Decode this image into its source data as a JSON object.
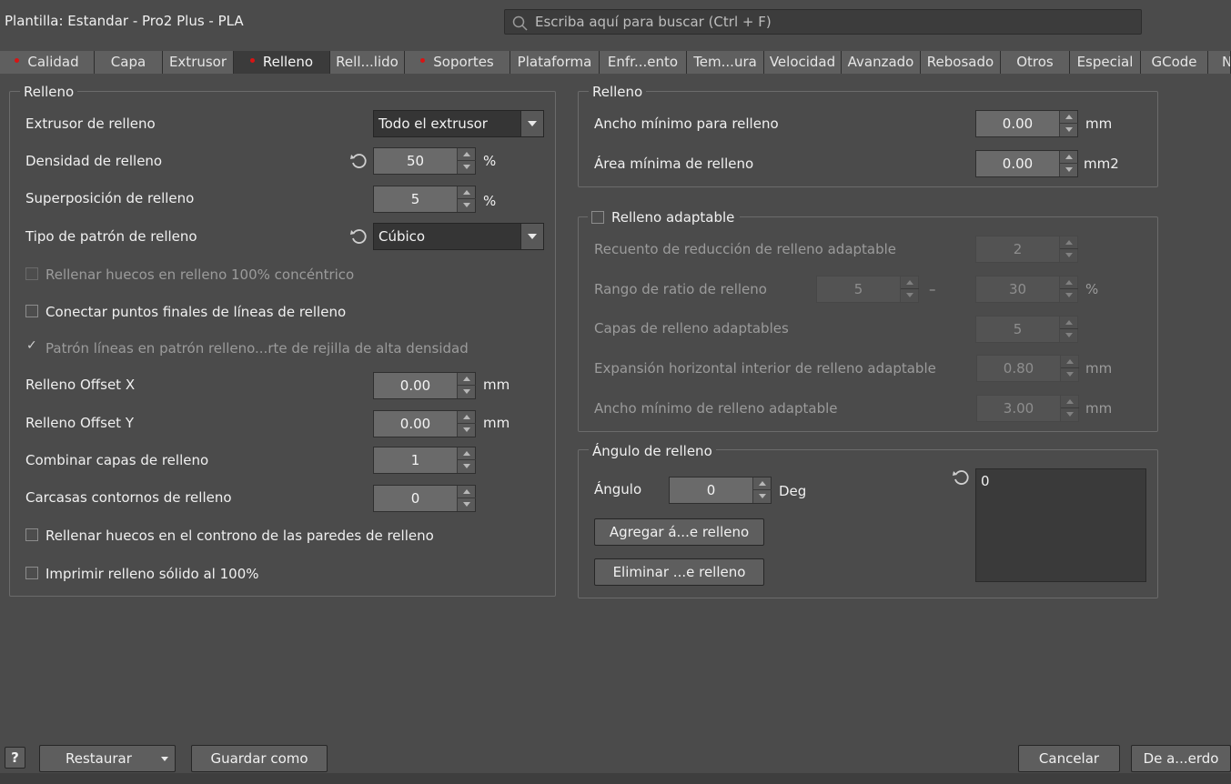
{
  "header": {
    "title": "Plantilla: Estandar - Pro2 Plus - PLA",
    "search_placeholder": "Escriba aquí para buscar (Ctrl + F)"
  },
  "tabs": [
    {
      "label": "Calidad",
      "modified": true
    },
    {
      "label": "Capa",
      "modified": false
    },
    {
      "label": "Extrusor",
      "modified": false
    },
    {
      "label": "Relleno",
      "modified": true,
      "active": true
    },
    {
      "label": "Rell...lido",
      "modified": false
    },
    {
      "label": "Soportes",
      "modified": true
    },
    {
      "label": "Plataforma",
      "modified": false
    },
    {
      "label": "Enfr...ento",
      "modified": false
    },
    {
      "label": "Tem...ura",
      "modified": false
    },
    {
      "label": "Velocidad",
      "modified": false
    },
    {
      "label": "Avanzado",
      "modified": false
    },
    {
      "label": "Rebosado",
      "modified": false
    },
    {
      "label": "Otros",
      "modified": false
    },
    {
      "label": "Especial",
      "modified": false
    },
    {
      "label": "GCode",
      "modified": false
    },
    {
      "label": "N",
      "modified": false
    }
  ],
  "left": {
    "group_title": "Relleno",
    "extruder_label": "Extrusor de relleno",
    "extruder_value": "Todo el extrusor",
    "density_label": "Densidad de relleno",
    "density_value": "50",
    "density_unit": "%",
    "overlap_label": "Superposición de relleno",
    "overlap_value": "5",
    "overlap_unit": "%",
    "pattern_label": "Tipo de patrón de relleno",
    "pattern_value": "Cúbico",
    "fill_gaps_concentric_label": "Rellenar huecos en relleno 100% concéntrico",
    "fill_gaps_concentric_checked": false,
    "connect_endpoints_label": "Conectar puntos finales de líneas de relleno",
    "connect_endpoints_checked": false,
    "lines_pattern_label": "Patrón líneas en patrón relleno...rte de rejilla de alta densidad",
    "lines_pattern_checked": true,
    "offset_x_label": "Relleno Offset X",
    "offset_x_value": "0.00",
    "offset_x_unit": "mm",
    "offset_y_label": "Relleno Offset Y",
    "offset_y_value": "0.00",
    "offset_y_unit": "mm",
    "combine_label": "Combinar capas de relleno",
    "combine_value": "1",
    "shells_label": "Carcasas contornos de relleno",
    "shells_value": "0",
    "fill_gaps_walls_label": "Rellenar huecos en el controno de las paredes de relleno",
    "fill_gaps_walls_checked": false,
    "solid_label": "Imprimir relleno sólido al 100%",
    "solid_checked": false
  },
  "right_top": {
    "group_title": "Relleno",
    "min_width_label": "Ancho mínimo para relleno",
    "min_width_value": "0.00",
    "min_width_unit": "mm",
    "min_area_label": "Área mínima de relleno",
    "min_area_value": "0.00",
    "min_area_unit": "mm2"
  },
  "adaptive": {
    "group_title": "Relleno adaptable",
    "enabled": false,
    "reduction_count_label": "Recuento de reducción de relleno adaptable",
    "reduction_count_value": "2",
    "ratio_range_label": "Rango de ratio de relleno",
    "ratio_min_value": "5",
    "ratio_dash": "–",
    "ratio_max_value": "30",
    "ratio_unit": "%",
    "layers_label": "Capas de relleno adaptables",
    "layers_value": "5",
    "h_expansion_label": "Expansión horizontal interior de relleno adaptable",
    "h_expansion_value": "0.80",
    "h_expansion_unit": "mm",
    "min_width_label": "Ancho mínimo de relleno adaptable",
    "min_width_value": "3.00",
    "min_width_unit": "mm"
  },
  "angle": {
    "group_title": "Ángulo de relleno",
    "angle_label": "Ángulo",
    "angle_value": "0",
    "angle_unit": "Deg",
    "add_button": "Agregar á...e relleno",
    "remove_button": "Eliminar ...e relleno",
    "list": [
      "0"
    ]
  },
  "footer": {
    "help": "?",
    "restore": "Restaurar",
    "save_as": "Guardar como",
    "cancel": "Cancelar",
    "ok": "De a...erdo"
  },
  "icons": {
    "search": "search-icon",
    "reset": "reset-icon",
    "dropdown": "chevron-down-icon"
  },
  "colors": {
    "background": "#4b4b4b",
    "modified_dot": "#d81414",
    "active_tab": "#3b3b3b"
  }
}
